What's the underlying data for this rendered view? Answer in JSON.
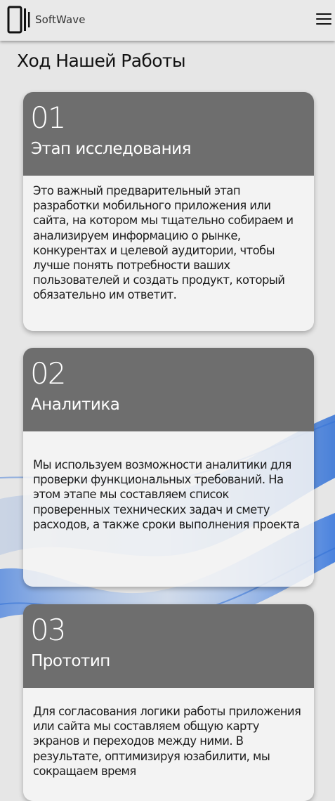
{
  "header": {
    "logo_text": "SoftWave",
    "logo_icon": "phone-logo-icon",
    "menu_icon": "hamburger-menu-icon"
  },
  "page": {
    "title": "Ход Нашей Работы"
  },
  "steps": [
    {
      "number": "01",
      "title": "Этап исследования",
      "text": "Это важный предварительный этап разработки мобильного приложения или сайта, на котором мы тщательно собираем и анализируем информацию о рынке, конкурентах и целевой аудитории, чтобы лучше понять потребности ваших пользователей и создать продукт, который обязательно им ответит."
    },
    {
      "number": "02",
      "title": "Аналитика",
      "text": "Мы используем возможности аналитики для проверки функциональных требований. На этом этапе мы составляем список проверенных технических задач и смету расходов, а также сроки выполнения проекта"
    },
    {
      "number": "03",
      "title": "Прототип",
      "text": "Для согласования логики работы приложения или сайта мы составляем общую карту экранов и переходов между ними. В результате, оптимизируя юзабилити, мы сокращаем время"
    }
  ],
  "colors": {
    "background": "#e6e6e6",
    "card_header": "#6e6e6e",
    "card_body": "#f4f4f4",
    "wave_accent": "#2f6fd6"
  }
}
